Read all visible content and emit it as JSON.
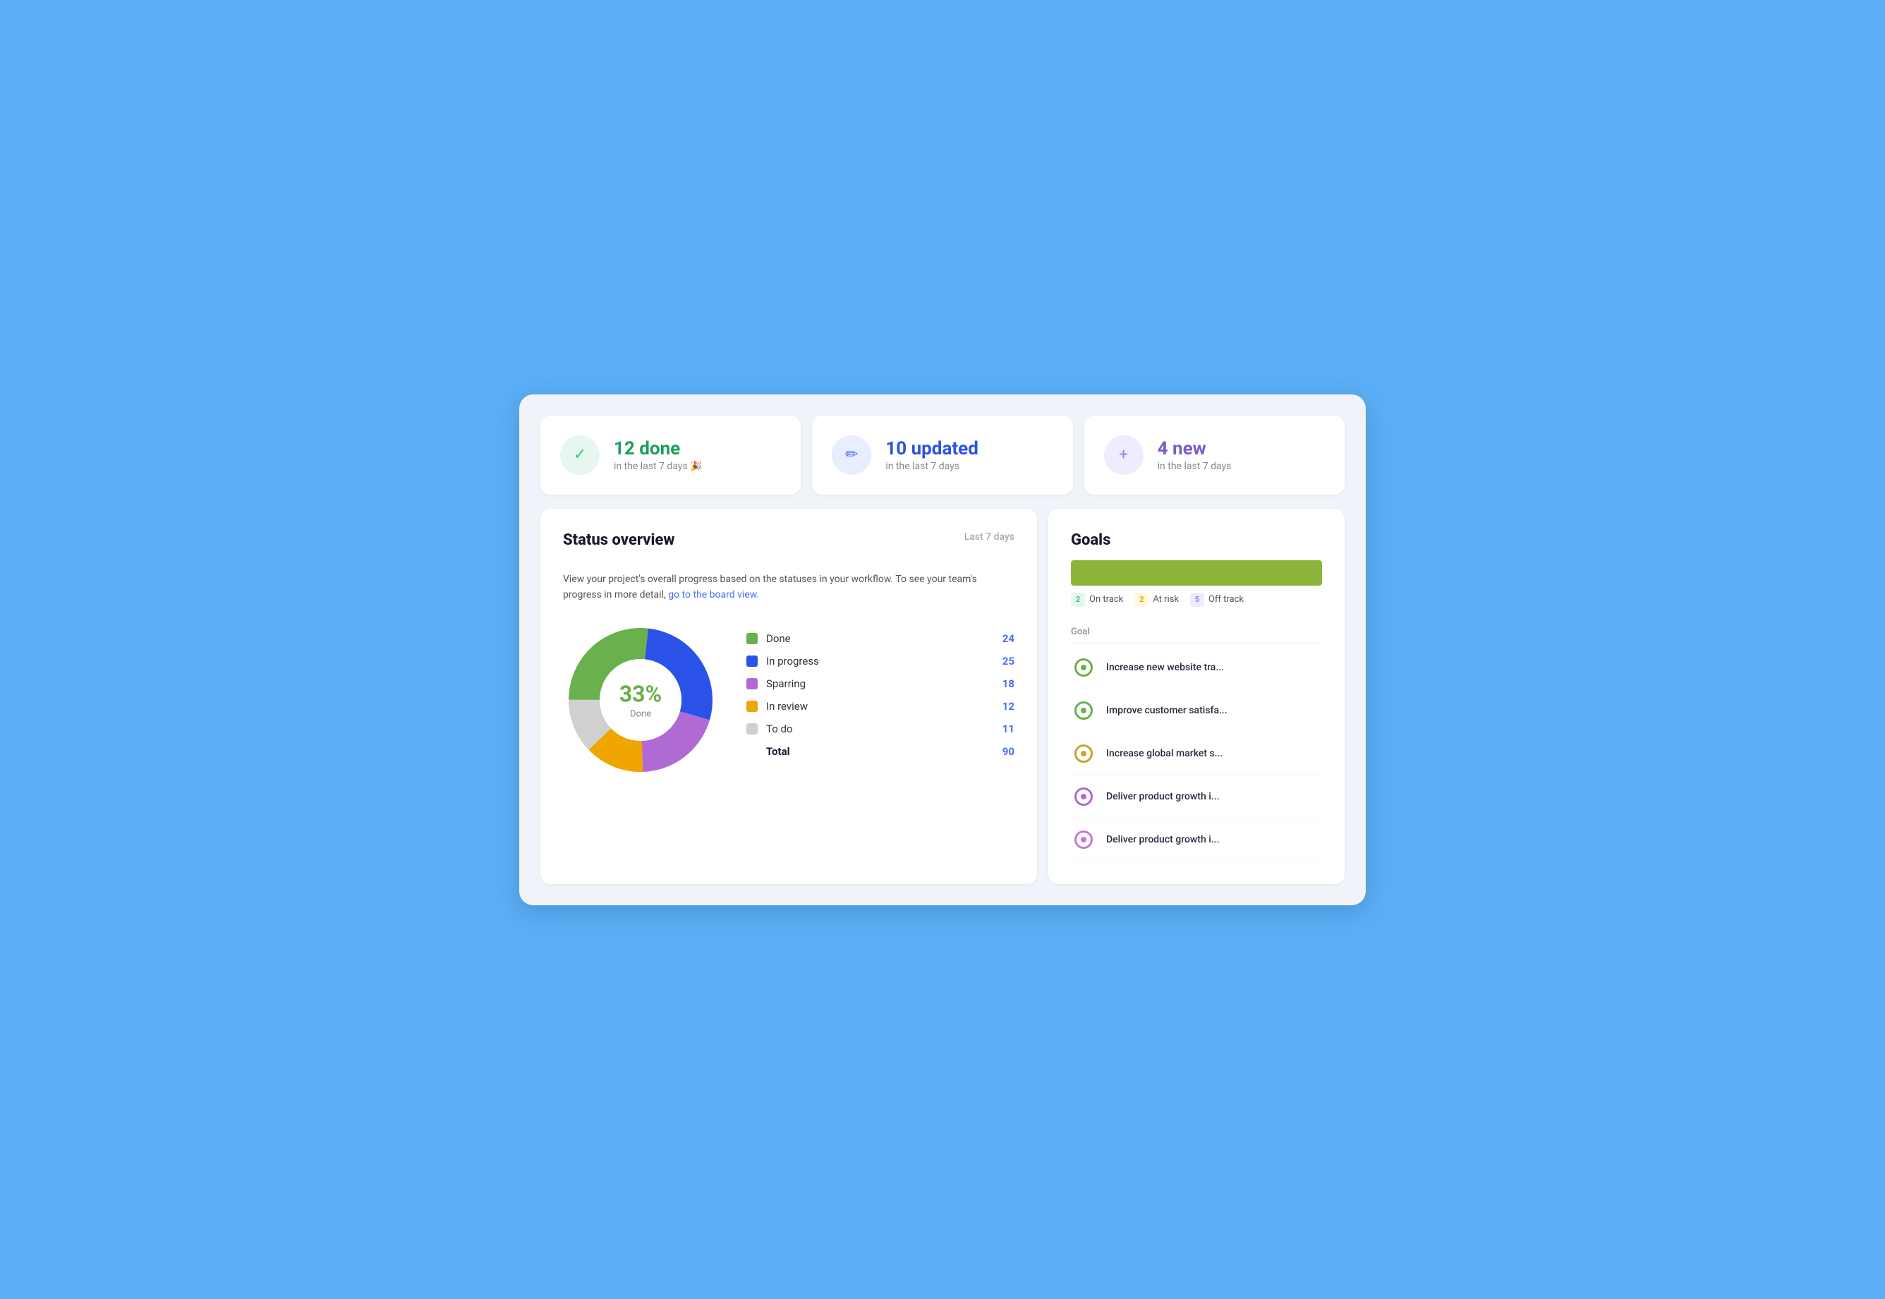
{
  "stats": [
    {
      "id": "done",
      "main_number": "12 done",
      "sub_text": "in the last 7 days 🎉",
      "icon_char": "✓",
      "color_class": "green"
    },
    {
      "id": "updated",
      "main_number": "10 updated",
      "sub_text": "in the last 7 days",
      "icon_char": "✏",
      "color_class": "blue"
    },
    {
      "id": "new",
      "main_number": "4 new",
      "sub_text": "in the last 7 days",
      "icon_char": "+",
      "color_class": "purple"
    }
  ],
  "status_overview": {
    "title": "Status overview",
    "period_label": "Last 7 days",
    "description": "View your project's overall progress based on the statuses in your workflow. To see your team's progress in more detail,",
    "link_text": "go to the board view.",
    "donut": {
      "percentage": "33%",
      "label": "Done"
    },
    "legend": [
      {
        "name": "Done",
        "count": "24",
        "color": "#6ab04c"
      },
      {
        "name": "In progress",
        "count": "25",
        "color": "#2a52e8"
      },
      {
        "name": "Sparring",
        "count": "18",
        "color": "#b06ad4"
      },
      {
        "name": "In review",
        "count": "12",
        "color": "#f0a500"
      },
      {
        "name": "To do",
        "count": "11",
        "color": "#d0d0d0"
      },
      {
        "name": "Total",
        "count": "90",
        "is_total": true
      }
    ]
  },
  "goals": {
    "title": "Goals",
    "bar_color": "#8cb43a",
    "legend_items": [
      {
        "label": "On track",
        "count": "2",
        "badge_class": "badge-green"
      },
      {
        "label": "At risk",
        "count": "2",
        "badge_class": "badge-yellow"
      },
      {
        "label": "Off track",
        "count": "5",
        "badge_class": "badge-purple"
      }
    ],
    "column_label": "Goal",
    "rows": [
      {
        "name": "Increase new website tra...",
        "color_class": "color-green-goal"
      },
      {
        "name": "Improve customer satisfa...",
        "color_class": "color-green-goal"
      },
      {
        "name": "Increase global market s...",
        "color_class": "color-yellow-goal"
      },
      {
        "name": "Deliver product growth i...",
        "color_class": "color-purple-goal"
      },
      {
        "name": "Deliver product growth i...",
        "color_class": "color-purple2-goal"
      }
    ]
  }
}
